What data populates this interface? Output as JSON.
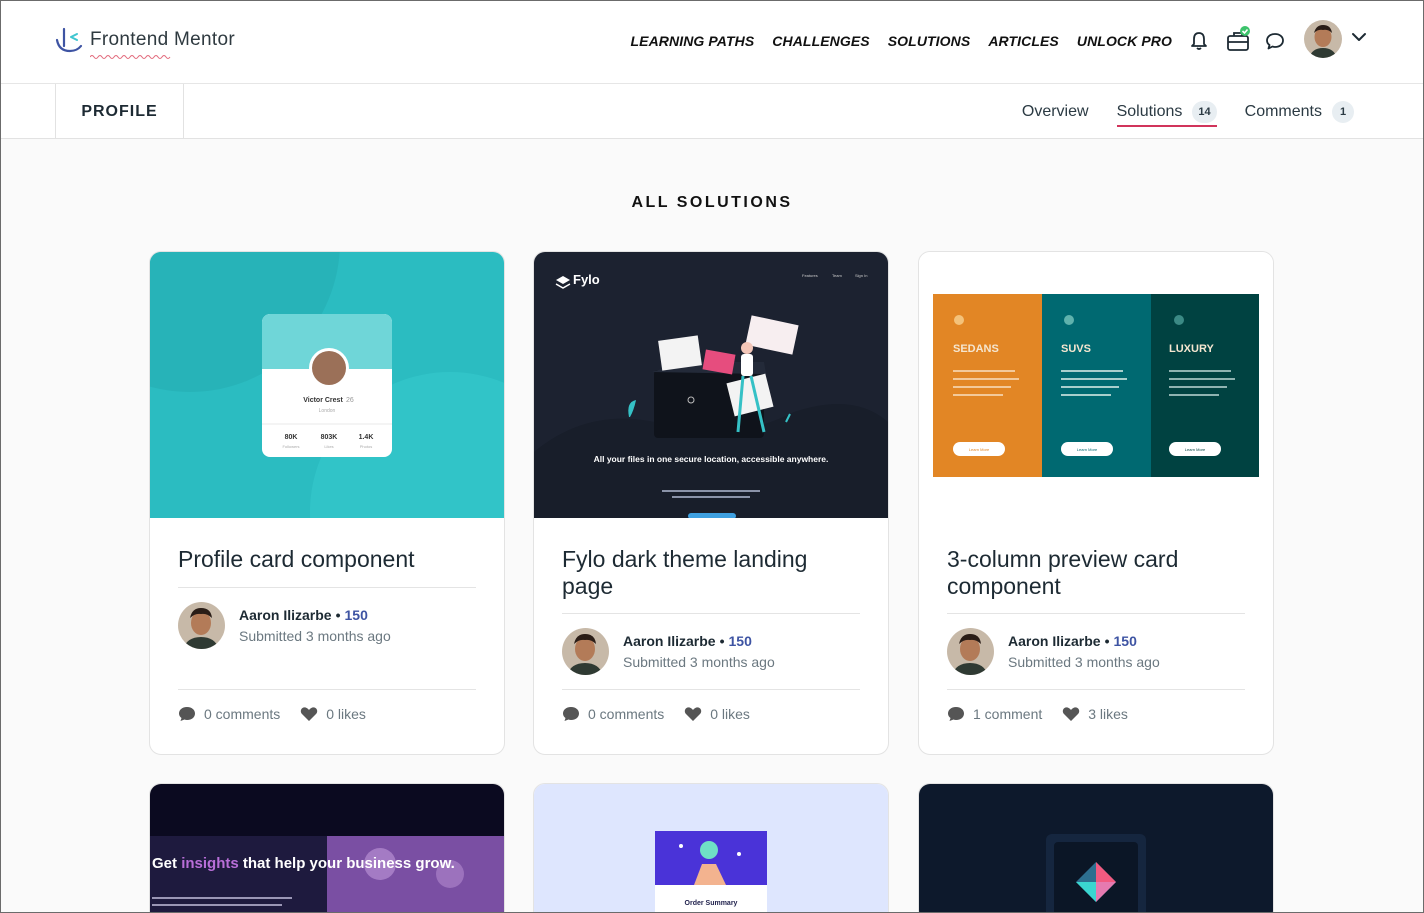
{
  "header": {
    "logo_text": "Frontend Mentor",
    "nav": [
      "LEARNING PATHS",
      "CHALLENGES",
      "SOLUTIONS",
      "ARTICLES",
      "UNLOCK PRO"
    ]
  },
  "subheader": {
    "profile_label": "PROFILE",
    "tabs": [
      {
        "label": "Overview",
        "badge": ""
      },
      {
        "label": "Solutions",
        "badge": "14"
      },
      {
        "label": "Comments",
        "badge": "1"
      }
    ]
  },
  "section": {
    "title": "ALL SOLUTIONS"
  },
  "cards": [
    {
      "title": "Profile card component",
      "author": "Aaron Ilizarbe",
      "score": "150",
      "submitted": "Submitted 3 months ago",
      "comments": "0 comments",
      "likes": "0 likes",
      "preview": {
        "name": "Victor Crest",
        "age": "26",
        "city": "London",
        "stats": [
          {
            "value": "80K",
            "label": "Followers"
          },
          {
            "value": "803K",
            "label": "Likes"
          },
          {
            "value": "1.4K",
            "label": "Photos"
          }
        ]
      }
    },
    {
      "title": "Fylo dark theme landing page",
      "author": "Aaron Ilizarbe",
      "score": "150",
      "submitted": "Submitted 3 months ago",
      "comments": "0 comments",
      "likes": "0 likes",
      "preview": {
        "brand": "Fylo",
        "nav": [
          "Features",
          "Team",
          "Sign In"
        ],
        "headline": "All your files in one secure location, accessible anywhere."
      }
    },
    {
      "title": "3-column preview card component",
      "author": "Aaron Ilizarbe",
      "score": "150",
      "submitted": "Submitted 3 months ago",
      "comments": "1 comment",
      "likes": "3 likes",
      "preview": {
        "columns": [
          "SEDANS",
          "SUVS",
          "LUXURY"
        ],
        "button": "Learn More"
      }
    },
    {
      "preview": {
        "headline_a": "Get ",
        "headline_b": "insights",
        "headline_c": " that help your business grow."
      }
    },
    {
      "preview": {
        "label": "Order Summary"
      }
    },
    {
      "preview": {}
    }
  ],
  "colors": {
    "accent": "#d1345b",
    "score": "#3e54a3",
    "profile_bg": "#2bbcc1",
    "fylo_bg": "#1c2230"
  }
}
